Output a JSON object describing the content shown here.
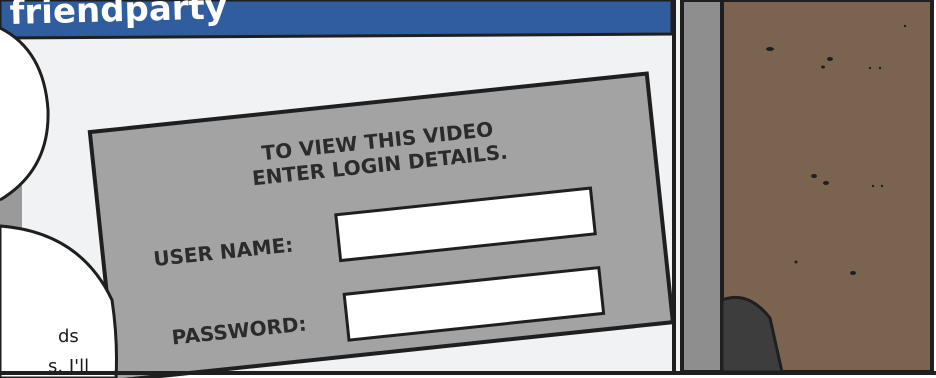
{
  "site": {
    "brand": "friendparty"
  },
  "login": {
    "heading_line1": "TO VIEW THIS VIDEO",
    "heading_line2": "ENTER LOGIN DETAILS.",
    "username_label": "USER NAME:",
    "username_value": "",
    "password_label": "PASSWORD:",
    "password_value": ""
  },
  "speech_bubble": {
    "line1": "ds",
    "line2": "s. I'll"
  },
  "colors": {
    "header_blue": "#2f5d9e",
    "dialog_gray": "#a3a3a3",
    "frame_gray": "#8e8e8e",
    "wall_brown": "#7a6450",
    "outline": "#1f1f1f"
  }
}
